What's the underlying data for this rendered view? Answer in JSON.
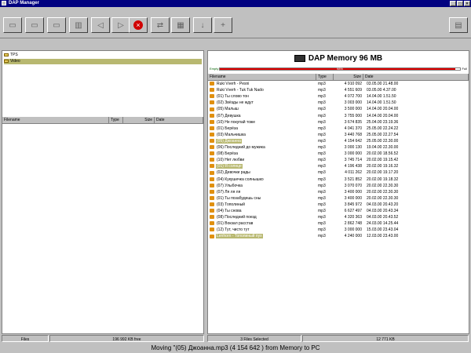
{
  "app": {
    "title": "DAP Manager"
  },
  "menu": [
    " ",
    " ",
    " ",
    " "
  ],
  "pc_panel": {
    "tree": [
      {
        "label": "TPS",
        "selected": false
      },
      {
        "label": "Video",
        "selected": true
      }
    ],
    "columns": [
      "Filename",
      "Type",
      "Size",
      "Date"
    ]
  },
  "dap_panel": {
    "title": "DAP Memory 96 MB",
    "empty_label": "Empty",
    "full_label": "Full",
    "capacity_percent": 98,
    "capacity_text": "98%",
    "columns": [
      "Filename",
      "Type",
      "Size",
      "Date"
    ],
    "files": [
      {
        "name": "Ruki Vverh - Pesni",
        "type": "mp3",
        "size": "4 910 092",
        "date": "03.05.00 21.48.00",
        "selected": false
      },
      {
        "name": "Ruki Vverh - Tuk Tuk Nado",
        "type": "mp3",
        "size": "4 551 609",
        "date": "03.05.00 4.37.00",
        "selected": false
      },
      {
        "name": "(01) Ты слово тон",
        "type": "mp3",
        "size": "4 072 700",
        "date": "14.04.00 1.51.50",
        "selected": false
      },
      {
        "name": "(02) Звёзды не ждут",
        "type": "mp3",
        "size": "3 003 000",
        "date": "14.04.00 1.51.50",
        "selected": false
      },
      {
        "name": "(05) Малыш",
        "type": "mp3",
        "size": "3 500 000",
        "date": "14.04.00 20.04.00",
        "selected": false
      },
      {
        "name": "(07) Девушка",
        "type": "mp3",
        "size": "3 755 000",
        "date": "14.04.00 20.04.00",
        "selected": false
      },
      {
        "name": "(10) Не покупай тоже",
        "type": "mp3",
        "size": "3 674 835",
        "date": "25.04.00 23.19.36",
        "selected": false
      },
      {
        "name": "(01) Берёза",
        "type": "mp3",
        "size": "4 041 370",
        "date": "25.05.00 22.24.22",
        "selected": false
      },
      {
        "name": "(03) Мальчишка",
        "type": "mp3",
        "size": "3 440 768",
        "date": "25.05.00 22.27.54",
        "selected": false
      },
      {
        "name": "(05) Джоанна",
        "type": "mp3",
        "size": "4 154 642",
        "date": "25.05.00 22.30.00",
        "selected": true
      },
      {
        "name": "(06) Последний до мужика",
        "type": "mp3",
        "size": "3 000 130",
        "date": "19.04.00 22.30.00",
        "selected": false
      },
      {
        "name": "(08) Берёза",
        "type": "mp3",
        "size": "3 000 000",
        "date": "20.02.00 18.56.52",
        "selected": false
      },
      {
        "name": "(10) Нет любви",
        "type": "mp3",
        "size": "3 745 714",
        "date": "20.02.00 19.15.42",
        "selected": false
      },
      {
        "name": "(01) Я солнце",
        "type": "mp3",
        "size": "4 196 438",
        "date": "20.02.00 19.16.32",
        "selected": true
      },
      {
        "name": "(02) Девочки рады",
        "type": "mp3",
        "size": "4 011 262",
        "date": "20.02.00 19.17.20",
        "selected": false
      },
      {
        "name": "(04) Кукушечка солнышко",
        "type": "mp3",
        "size": "3 521 852",
        "date": "20.02.00 19.18.32",
        "selected": false
      },
      {
        "name": "(07) Улыбочка",
        "type": "mp3",
        "size": "3 070 070",
        "date": "20.02.00 22.30.30",
        "selected": false
      },
      {
        "name": "(07) Ля ля ля",
        "type": "mp3",
        "size": "3 400 000",
        "date": "20.02.00 22.30.30",
        "selected": false
      },
      {
        "name": "(01) Ты позабудешь сны",
        "type": "mp3",
        "size": "3 400 000",
        "date": "20.02.00 22.30.30",
        "selected": false
      },
      {
        "name": "(03) Тополиный",
        "type": "mp3",
        "size": "3 845 972",
        "date": "04.03.00 20.43.20",
        "selected": false
      },
      {
        "name": "(04) Ты снова",
        "type": "mp3",
        "size": "6 627 497",
        "date": "04.03.00 20.43.34",
        "selected": false
      },
      {
        "name": "(08) Последний поезд",
        "type": "mp3",
        "size": "4 320 363",
        "date": "04.03.00 20.43.52",
        "selected": false
      },
      {
        "name": "(01) Вокзал расстав",
        "type": "mp3",
        "size": "2 862 748",
        "date": "24.03.00 14.25.44",
        "selected": false
      },
      {
        "name": "(12) Тут, чисто тут",
        "type": "mp3",
        "size": "3 000 000",
        "date": "15.03.00 23.43.04",
        "selected": false
      },
      {
        "name": "Lenhorn - Тополиный пух",
        "type": "mp3",
        "size": "4 240 000",
        "date": "12.03.00 23.43.00",
        "selected": true
      }
    ]
  },
  "status": {
    "left_files": "Files",
    "left_size": "196 992 KB free",
    "right_selected": "3 Files Selected",
    "right_size": "12 771 KB"
  },
  "message": "Moving \"(05) Джоанна.mp3 (4 154 642 ) from Memory to PC"
}
